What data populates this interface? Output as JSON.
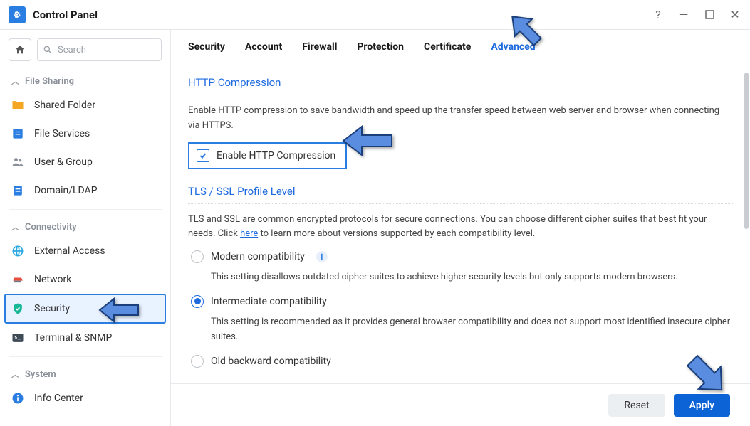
{
  "window": {
    "title": "Control Panel"
  },
  "search": {
    "placeholder": "Search"
  },
  "sidebar": {
    "groups": [
      {
        "label": "File Sharing"
      },
      {
        "label": "Connectivity"
      },
      {
        "label": "System"
      }
    ],
    "items": {
      "shared_folder": "Shared Folder",
      "file_services": "File Services",
      "user_group": "User & Group",
      "domain_ldap": "Domain/LDAP",
      "external_access": "External Access",
      "network": "Network",
      "security": "Security",
      "terminal_snmp": "Terminal & SNMP",
      "info_center": "Info Center"
    }
  },
  "tabs": {
    "security": "Security",
    "account": "Account",
    "firewall": "Firewall",
    "protection": "Protection",
    "certificate": "Certificate",
    "advanced": "Advanced"
  },
  "http_compression": {
    "title": "HTTP Compression",
    "desc": "Enable HTTP compression to save bandwidth and speed up the transfer speed between web server and browser when connecting via HTTPS.",
    "checkbox_label": "Enable HTTP Compression",
    "checked": true
  },
  "tls": {
    "title": "TLS / SSL Profile Level",
    "desc_before": "TLS and SSL are common encrypted protocols for secure connections. You can choose different cipher suites that best fit your needs. Click ",
    "link": "here",
    "desc_after": " to learn more about versions supported by each compatibility level.",
    "options": [
      {
        "label": "Modern compatibility",
        "desc": "This setting disallows outdated cipher suites to achieve higher security levels but only supports modern browsers.",
        "checked": false,
        "info": true
      },
      {
        "label": "Intermediate compatibility",
        "desc": "This setting is recommended as it provides general browser compatibility and does not support most identified insecure cipher suites.",
        "checked": true,
        "info": false
      },
      {
        "label": "Old backward compatibility",
        "desc": "",
        "checked": false,
        "info": false
      }
    ]
  },
  "footer": {
    "reset": "Reset",
    "apply": "Apply"
  }
}
